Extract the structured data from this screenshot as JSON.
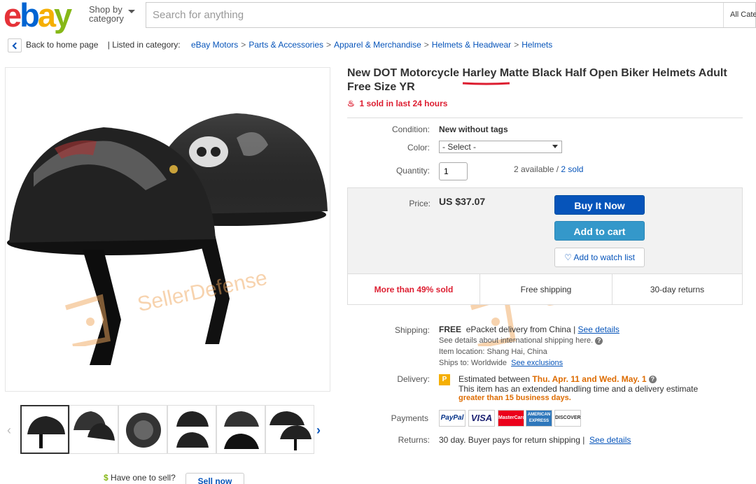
{
  "header": {
    "logo_letters": [
      "e",
      "b",
      "a",
      "y"
    ],
    "logo_colors": [
      "#e53238",
      "#0064d2",
      "#f5af02",
      "#86b817"
    ],
    "shop_by_line1": "Shop by",
    "shop_by_line2": "category",
    "search_placeholder": "Search for anything",
    "category_select": "All Cate"
  },
  "breadcrumb": {
    "back_label": "Back to home page",
    "listed_label": "| Listed in category:",
    "items": [
      "eBay Motors",
      "Parts & Accessories",
      "Apparel & Merchandise",
      "Helmets & Headwear",
      "Helmets"
    ]
  },
  "product": {
    "title": "New DOT Motorcycle Harley Matte Black Half Open Biker Helmets Adult Free Size YR",
    "sold_recent": "1 sold in last 24 hours",
    "condition_label": "Condition:",
    "condition_value": "New without tags",
    "color_label": "Color:",
    "color_value": "- Select -",
    "quantity_label": "Quantity:",
    "quantity_value": "1",
    "available": "2 available",
    "sold": "2 sold",
    "price_label": "Price:",
    "price": "US $37.07",
    "buy_now": "Buy It Now",
    "add_to_cart": "Add to cart",
    "watch": "Add to watch list",
    "more_sold": "More than 49% sold",
    "free_shipping": "Free shipping",
    "returns_days": "30-day returns"
  },
  "shipping": {
    "label": "Shipping:",
    "free": "FREE",
    "method": "ePacket delivery from China |",
    "see_details": "See details",
    "intl_note": "See details about international shipping here.",
    "location": "Item location:  Shang Hai, China",
    "ships_to": "Ships to:  Worldwide",
    "exclusions": "See exclusions"
  },
  "delivery": {
    "label": "Delivery:",
    "estimated": "Estimated between",
    "dates": "Thu. Apr. 11 and Wed. May. 1",
    "note": "This item has an extended handling time and a delivery estimate",
    "note2": "greater than 15 business days."
  },
  "payments": {
    "label": "Payments",
    "logos": [
      "PayPal",
      "VISA",
      "MasterCard",
      "AMERICAN EXPRESS",
      "DISCOVER"
    ]
  },
  "returns": {
    "label": "Returns:",
    "text": "30 day. Buyer pays for return shipping |",
    "see_details": "See details"
  },
  "sell": {
    "prompt": "Have one to sell?",
    "button": "Sell now"
  },
  "watermark": "SellerDefense",
  "colors": {
    "accent_blue": "#0654ba",
    "cart_blue": "#3498ca",
    "alert_red": "#dd1e31",
    "delivery_orange": "#dd6b00",
    "watermark": "#f0a860"
  }
}
